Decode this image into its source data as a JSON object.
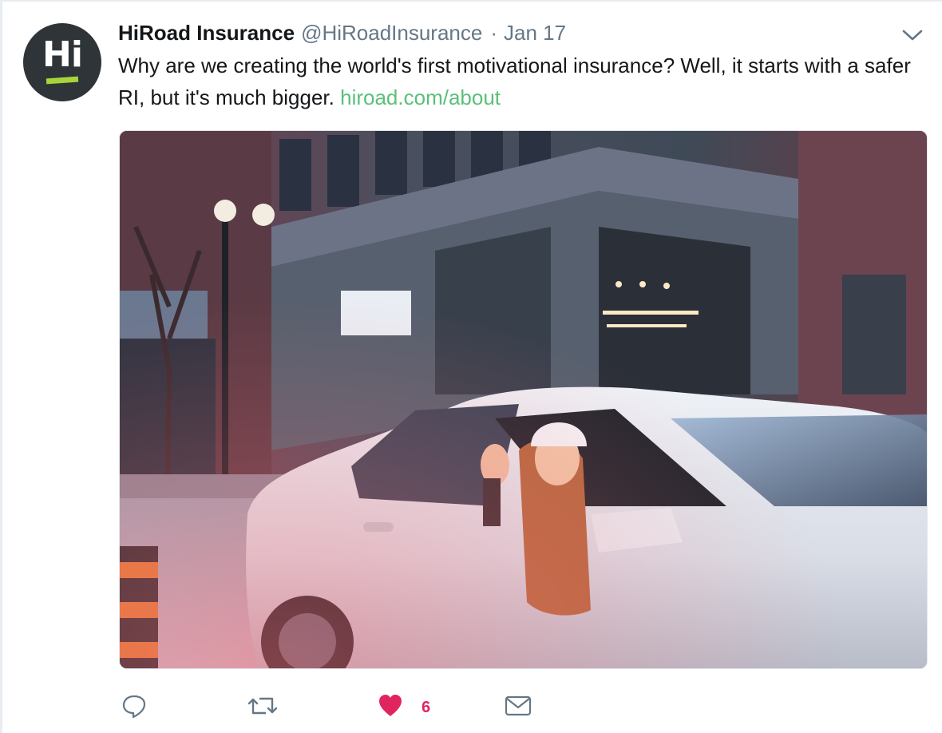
{
  "tweet": {
    "avatar_text": "Hi",
    "display_name": "HiRoad Insurance",
    "handle": "@HiRoadInsurance",
    "separator": "·",
    "date": "Jan 17",
    "text": "Why are we creating the world's first motivational insurance? Well, it starts with a safer RI, but it's much bigger.",
    "link_text": "hiroad.com/about",
    "colors": {
      "link": "#5bbf7a",
      "avatar_bg": "#2f3438",
      "avatar_bar": "#a6d53a",
      "like": "#e0245e",
      "icon": "#657786"
    }
  },
  "actions": {
    "reply_icon": "reply-icon",
    "retweet_icon": "retweet-icon",
    "like_icon": "heart-icon",
    "like_count": "6",
    "message_icon": "envelope-icon"
  },
  "menu": {
    "caret_icon": "chevron-down-icon"
  }
}
